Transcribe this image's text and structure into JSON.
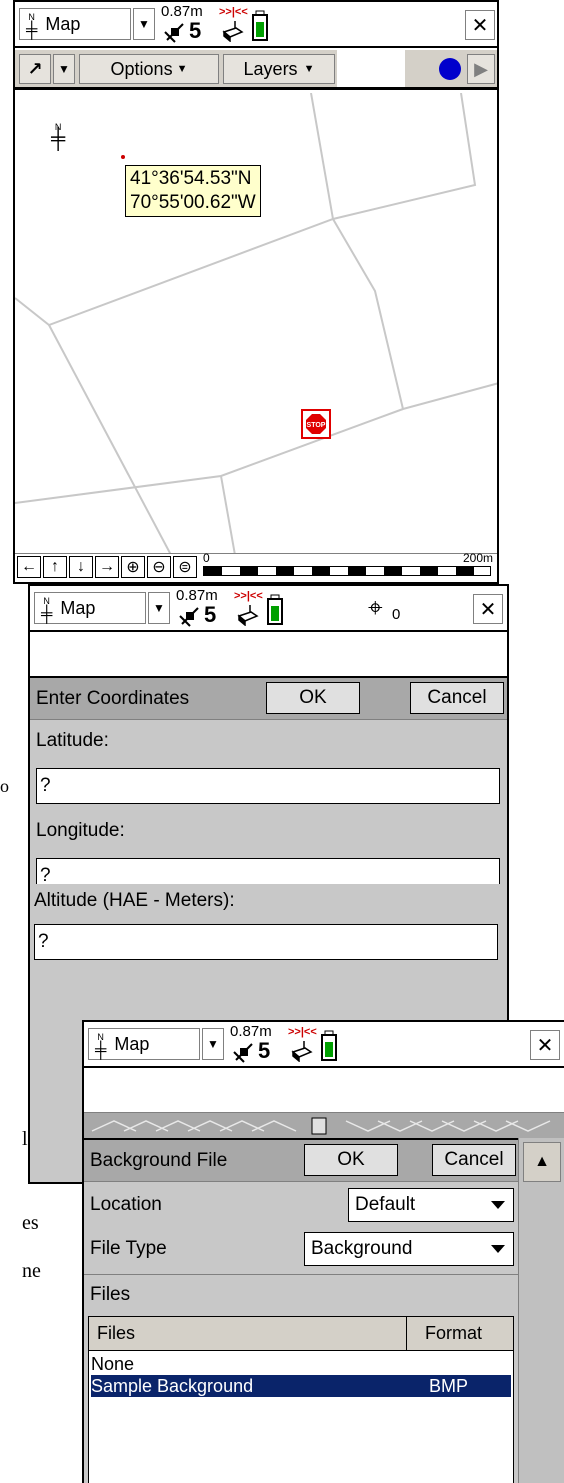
{
  "background_text": [
    "le,",
    "’",
    "es",
    "ne"
  ],
  "background_marker": "o",
  "map_window": {
    "map_label": "Map",
    "accuracy": "0.87m",
    "satellites": "5",
    "toolbar": {
      "options_label": "Options",
      "layers_label": "Layers"
    },
    "coordinate_popup": {
      "lat": "41°36'54.53\"N",
      "lon": "70°55'00.62\"W"
    },
    "scale": {
      "start": "0",
      "end": "200m"
    },
    "icons": [
      "north-arrow-icon",
      "satellite-icon",
      "receiver-icon",
      "battery-icon",
      "stop-sign-icon"
    ],
    "colors": {
      "gps_dot": "#0000cc",
      "stop_sign": "#e00000",
      "popup_bg": "#ffffcc"
    }
  },
  "coord_window": {
    "map_label": "Map",
    "accuracy": "0.87m",
    "satellites": "5",
    "crosshair_sub": "0",
    "form_title": "Enter Coordinates",
    "ok_label": "OK",
    "cancel_label": "Cancel",
    "latitude_label": "Latitude:",
    "latitude_value": "?",
    "longitude_label": "Longitude:",
    "longitude_value": "?",
    "altitude_label": "Altitude (HAE - Meters):",
    "altitude_value": "?"
  },
  "file_window": {
    "map_label": "Map",
    "accuracy": "0.87m",
    "satellites": "5",
    "form_title": "Background File",
    "ok_label": "OK",
    "cancel_label": "Cancel",
    "location_label": "Location",
    "location_value": "Default",
    "filetype_label": "File Type",
    "filetype_value": "Background",
    "files_section": "Files",
    "table_headers": [
      "Files",
      "Format"
    ],
    "rows": [
      {
        "name": "None",
        "format": ""
      },
      {
        "name": "Sample Background",
        "format": "BMP",
        "selected": true
      }
    ],
    "colors": {
      "selection": "#0a246a"
    }
  }
}
